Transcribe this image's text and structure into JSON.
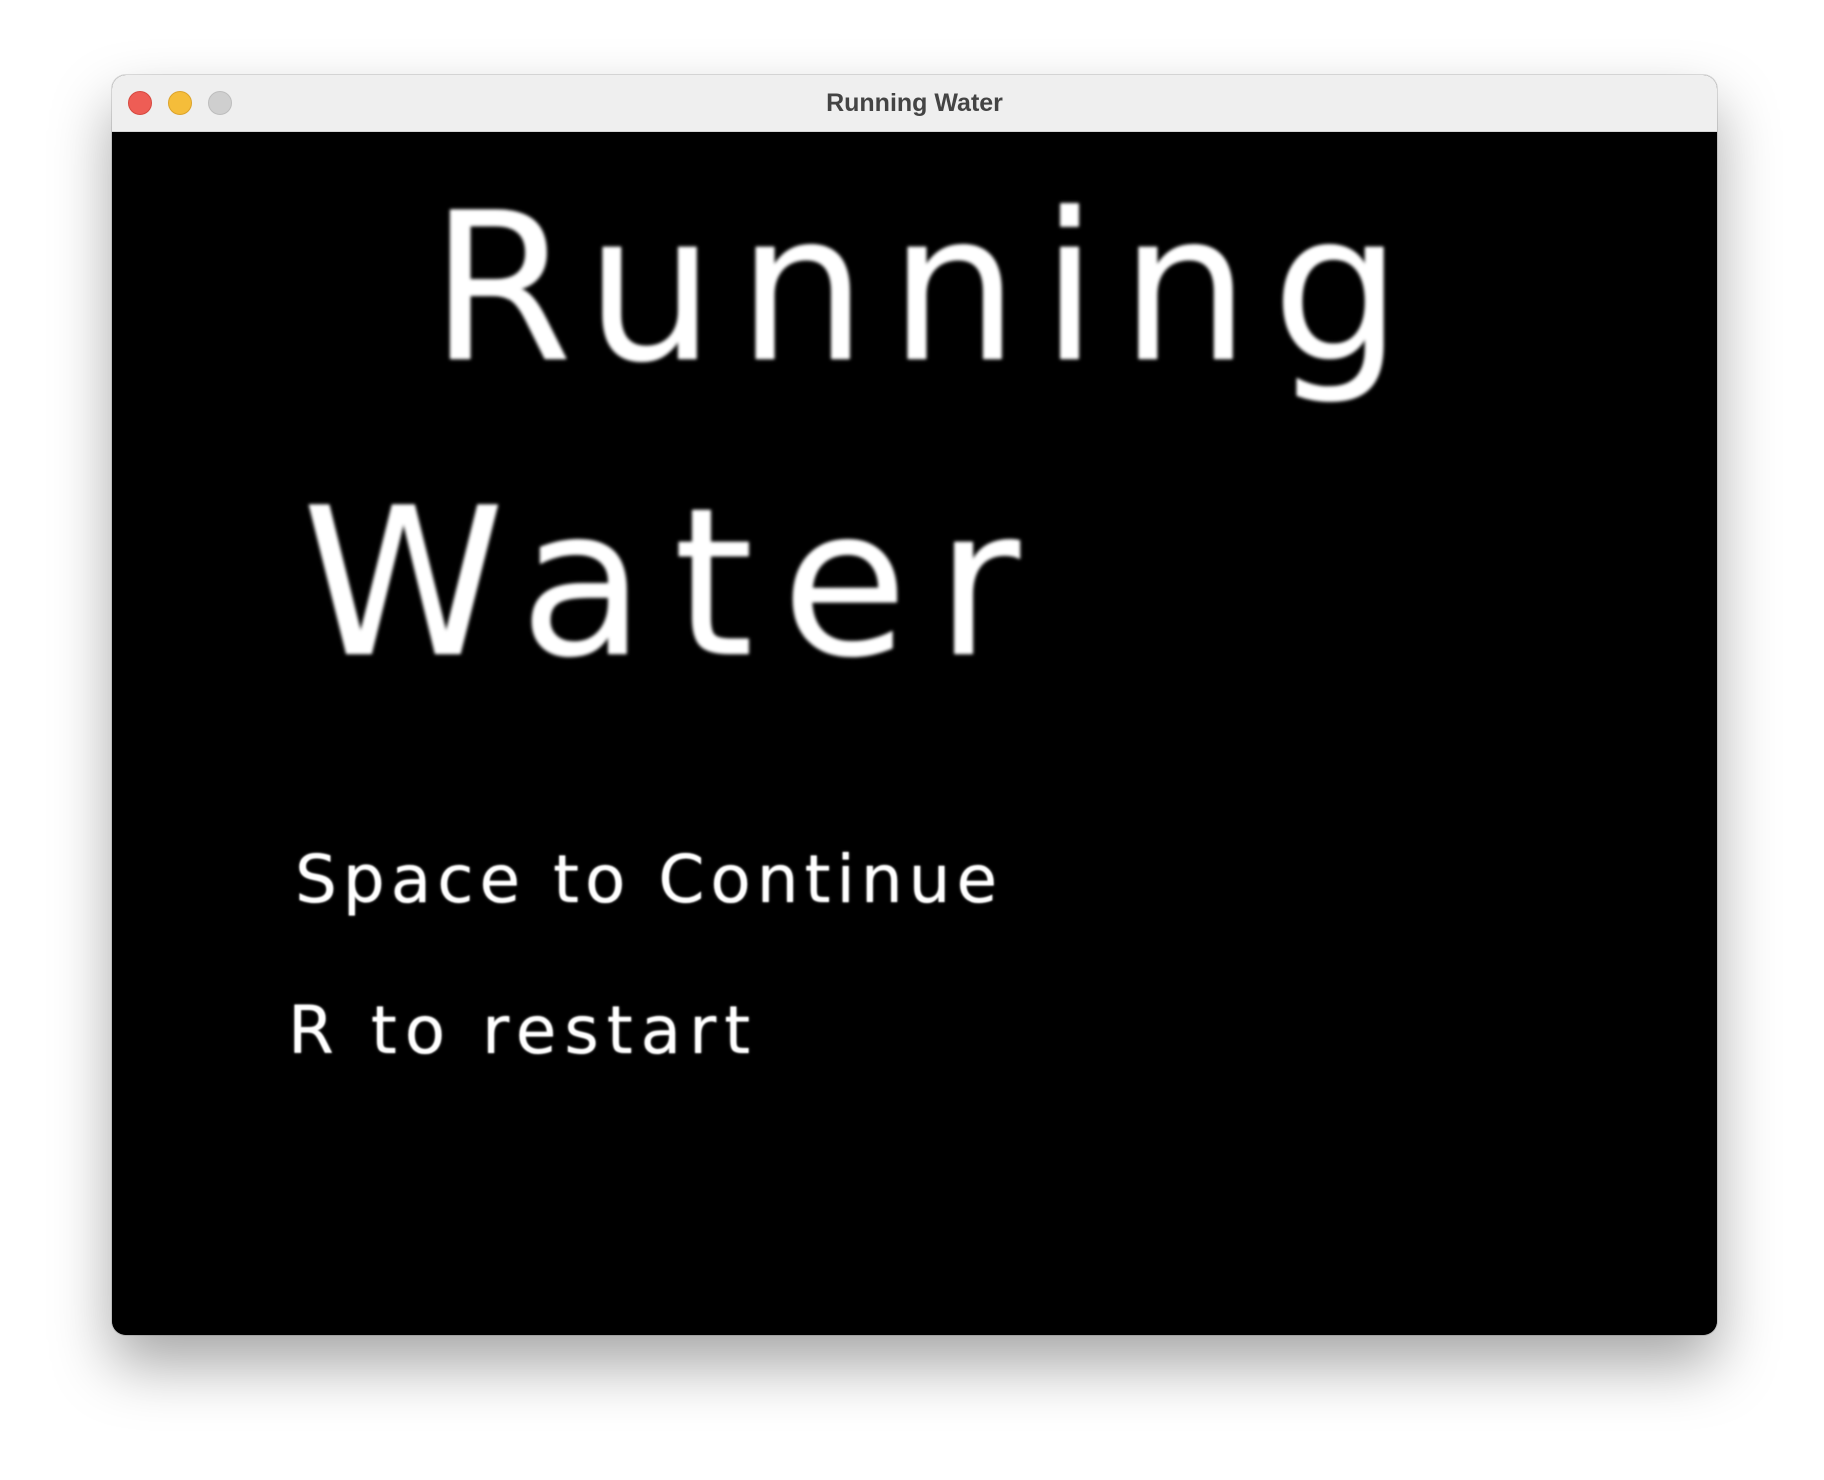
{
  "window": {
    "title": "Running Water",
    "controls": {
      "close_icon": "close-icon",
      "minimize_icon": "minimize-icon",
      "zoom_icon": "zoom-icon"
    }
  },
  "game": {
    "title_line1": "Running",
    "title_line2": "Water",
    "continue_prompt": "Space to Continue",
    "restart_prompt": "R to restart",
    "colors": {
      "background": "#000000",
      "text": "#ffffff"
    }
  }
}
